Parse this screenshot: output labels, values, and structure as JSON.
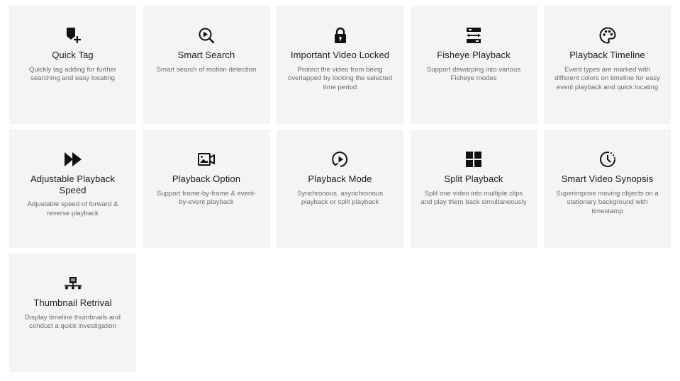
{
  "features": [
    {
      "icon": "tag-add-icon",
      "title": "Quick Tag",
      "description": "Quickly tag adding for further searching and easy locating"
    },
    {
      "icon": "search-play-icon",
      "title": "Smart Search",
      "description": "Smart search of motion detection"
    },
    {
      "icon": "lock-icon",
      "title": "Important Video Locked",
      "description": "Protect the video from being overlapped by locking the selected time period"
    },
    {
      "icon": "fisheye-arrows-icon",
      "title": "Fisheye Playback",
      "description": "Support dewarping into various Fisheye modes"
    },
    {
      "icon": "palette-icon",
      "title": "Playback Timeline",
      "description": "Event types are marked with different colors on timeline for easy event playback and quick locating"
    },
    {
      "icon": "fast-forward-icon",
      "title": "Adjustable Playback Speed",
      "description": "Adjustable speed of forward & reverse playback"
    },
    {
      "icon": "video-camera-icon",
      "title": "Playback Option",
      "description": "Support frame-by-frame & event-by-event playback"
    },
    {
      "icon": "play-circle-icon",
      "title": "Playback Mode",
      "description": "Synchronous, asynchronous playback or split playback"
    },
    {
      "icon": "grid-split-icon",
      "title": "Split Playback",
      "description": "Split one video into multiple clips and play them back simultaneously"
    },
    {
      "icon": "clock-dashed-icon",
      "title": "Smart Video Synopsis",
      "description": "Superimpose moving objects on a stationary background with timestamp"
    },
    {
      "icon": "thumbnail-timeline-icon",
      "title": "Thumbnail Retrival",
      "description": "Display timeline thumbnails and conduct a quick investigation"
    }
  ],
  "colors": {
    "card_background": "#f4f4f4",
    "title_text": "#1b1b1b",
    "description_text": "#6b6b6b",
    "icon": "#111111"
  }
}
